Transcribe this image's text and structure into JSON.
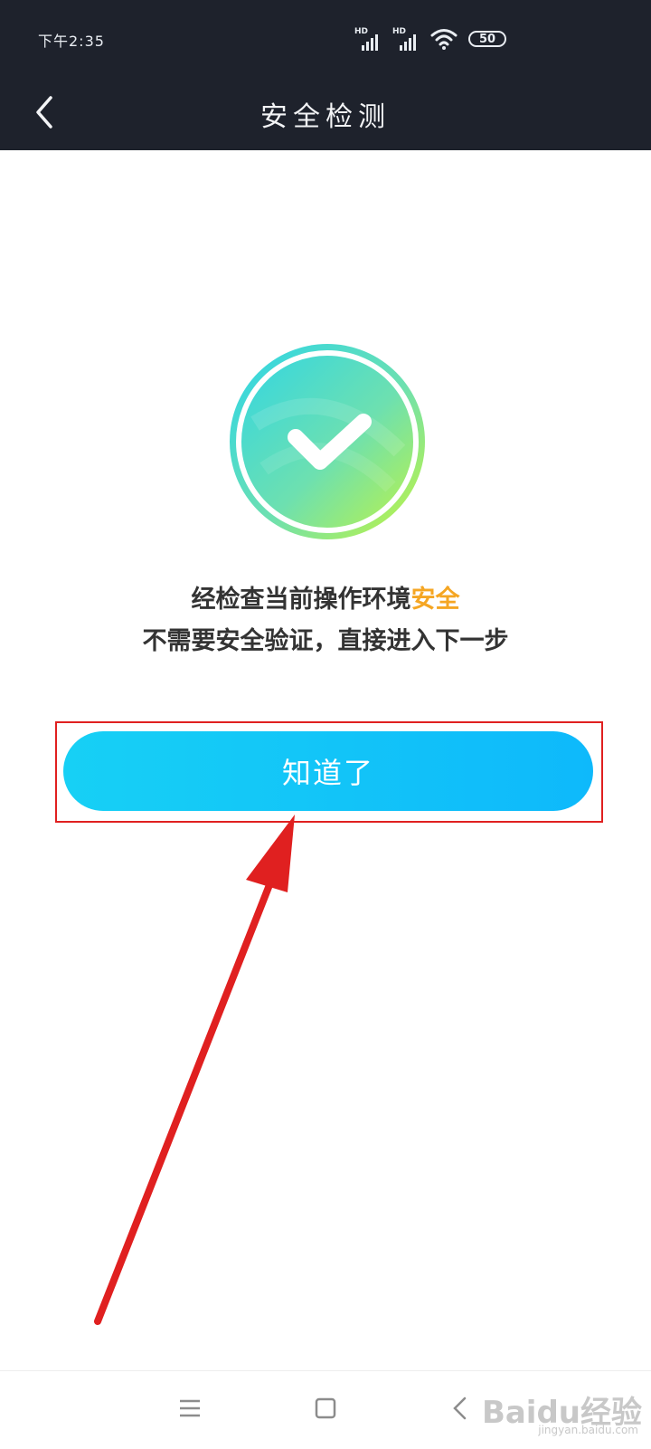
{
  "status_bar": {
    "time": "下午2:35",
    "signal1_label": "HD",
    "signal2_label": "HD",
    "battery": "50"
  },
  "navbar": {
    "title": "安全检测"
  },
  "result": {
    "line1_prefix": "经检查当前操作环境",
    "line1_highlight": "安全",
    "line2": "不需要安全验证，直接进入下一步"
  },
  "button": {
    "label": "知道了"
  },
  "watermark": {
    "text": "Baidu经验",
    "sub": "jingyan.baidu.com"
  },
  "colors": {
    "topbar": "#1e222c",
    "highlight_text": "#f5a623",
    "button_start": "#17d0f5",
    "button_end": "#0eb9fb",
    "annotation_red": "#e02020"
  }
}
